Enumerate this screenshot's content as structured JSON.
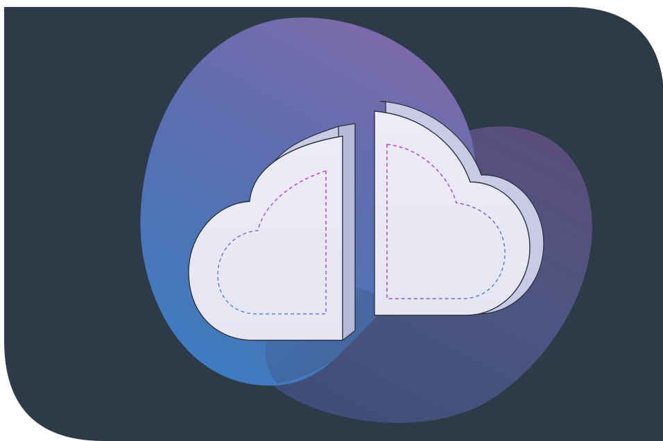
{
  "illustration": {
    "subject": "split-cloud-icon",
    "colors": {
      "page_background": "#ffffff",
      "panel": "#2d3a47",
      "blob_purple": "#7b6aa8",
      "blob_blue": "#3e7fc1",
      "blob_dark_purple": "#5a4f7f",
      "cloud_face": "#ebebf7",
      "cloud_side": "#c9cbe6",
      "cloud_outline": "#2c3340",
      "dash_blue": "#4a8fe0",
      "dash_purple": "#c43de0"
    }
  }
}
